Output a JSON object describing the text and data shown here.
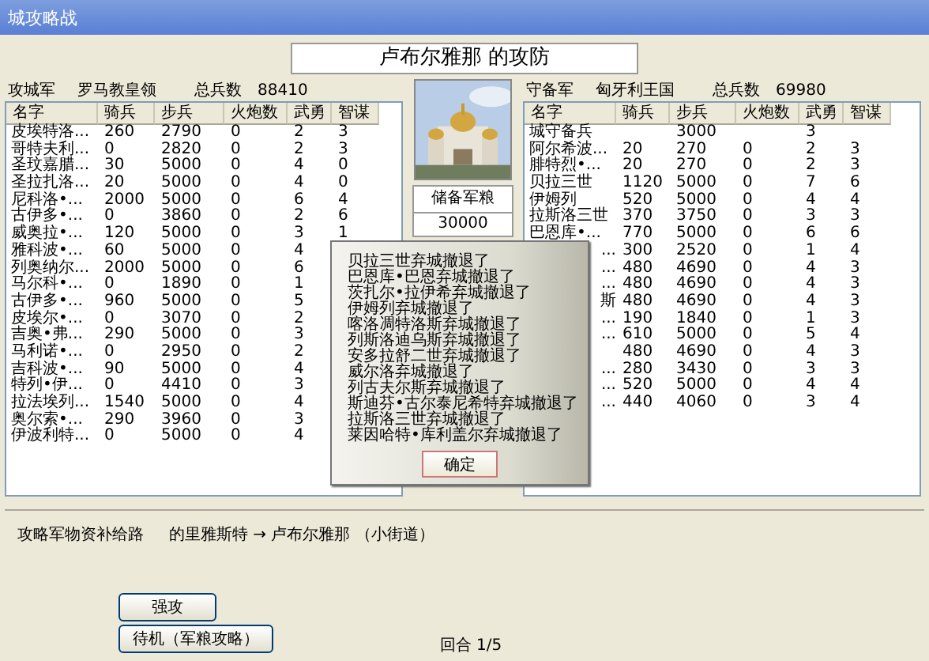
{
  "window": {
    "title": "城攻略战"
  },
  "battle_title": "卢布尔雅那 的攻防",
  "attacker": {
    "columns": [
      "名字",
      "骑兵",
      "步兵",
      "火炮数",
      "武勇",
      "智谋"
    ],
    "label": "攻城军",
    "faction": "罗马教皇领",
    "total_label": "总兵数",
    "total": "88410",
    "rows": [
      {
        "name": "皮埃特洛...",
        "cavalry": "260",
        "infantry": "2790",
        "cannons": "0",
        "valor": "2",
        "wisdom": "3"
      },
      {
        "name": "哥特夫利...",
        "cavalry": "0",
        "infantry": "2820",
        "cannons": "0",
        "valor": "2",
        "wisdom": "3"
      },
      {
        "name": "圣玟嘉腊...",
        "cavalry": "30",
        "infantry": "5000",
        "cannons": "0",
        "valor": "4",
        "wisdom": "0"
      },
      {
        "name": "圣拉扎洛...",
        "cavalry": "20",
        "infantry": "5000",
        "cannons": "0",
        "valor": "4",
        "wisdom": "0"
      },
      {
        "name": "尼科洛•...",
        "cavalry": "2000",
        "infantry": "5000",
        "cannons": "0",
        "valor": "6",
        "wisdom": "4"
      },
      {
        "name": "古伊多•...",
        "cavalry": "0",
        "infantry": "3860",
        "cannons": "0",
        "valor": "2",
        "wisdom": "6"
      },
      {
        "name": "威奥拉•...",
        "cavalry": "120",
        "infantry": "5000",
        "cannons": "0",
        "valor": "3",
        "wisdom": "1"
      },
      {
        "name": "雅科波•...",
        "cavalry": "60",
        "infantry": "5000",
        "cannons": "0",
        "valor": "4"
      },
      {
        "name": "列奥纳尔...",
        "cavalry": "2000",
        "infantry": "5000",
        "cannons": "0",
        "valor": "6"
      },
      {
        "name": "马尔科•...",
        "cavalry": "0",
        "infantry": "1890",
        "cannons": "0",
        "valor": "1"
      },
      {
        "name": "古伊多•...",
        "cavalry": "960",
        "infantry": "5000",
        "cannons": "0",
        "valor": "5"
      },
      {
        "name": "皮埃尔•...",
        "cavalry": "0",
        "infantry": "3070",
        "cannons": "0",
        "valor": "2"
      },
      {
        "name": "吉奥•弗...",
        "cavalry": "290",
        "infantry": "5000",
        "cannons": "0",
        "valor": "3"
      },
      {
        "name": "马利诺•...",
        "cavalry": "0",
        "infantry": "2950",
        "cannons": "0",
        "valor": "2"
      },
      {
        "name": "吉科波•...",
        "cavalry": "90",
        "infantry": "5000",
        "cannons": "0",
        "valor": "4"
      },
      {
        "name": "特列•伊...",
        "cavalry": "0",
        "infantry": "4410",
        "cannons": "0",
        "valor": "3"
      },
      {
        "name": "拉法埃列...",
        "cavalry": "1540",
        "infantry": "5000",
        "cannons": "0",
        "valor": "4"
      },
      {
        "name": "奥尔索•...",
        "cavalry": "290",
        "infantry": "3960",
        "cannons": "0",
        "valor": "3"
      },
      {
        "name": "伊波利特...",
        "cavalry": "0",
        "infantry": "5000",
        "cannons": "0",
        "valor": "4"
      }
    ]
  },
  "defender": {
    "columns": [
      "名字",
      "骑兵",
      "步兵",
      "火炮数",
      "武勇",
      "智谋"
    ],
    "label": "守备军",
    "faction": "匈牙利王国",
    "total_label": "总兵数",
    "total": "69980",
    "rows": [
      {
        "name": "城守备兵",
        "infantry": "3000",
        "valor": "3"
      },
      {
        "name": "阿尔希波...",
        "cavalry": "20",
        "infantry": "270",
        "cannons": "0",
        "valor": "2",
        "wisdom": "3"
      },
      {
        "name": "腓特烈•...",
        "cavalry": "20",
        "infantry": "270",
        "cannons": "0",
        "valor": "2",
        "wisdom": "3"
      },
      {
        "name": "贝拉三世",
        "cavalry": "1120",
        "infantry": "5000",
        "cannons": "0",
        "valor": "7",
        "wisdom": "6"
      },
      {
        "name": "伊姆列",
        "cavalry": "520",
        "infantry": "5000",
        "cannons": "0",
        "valor": "4",
        "wisdom": "4"
      },
      {
        "name": "拉斯洛三世",
        "cavalry": "370",
        "infantry": "3750",
        "cannons": "0",
        "valor": "3",
        "wisdom": "3"
      },
      {
        "name": "巴恩库•...",
        "cavalry": "770",
        "infantry": "5000",
        "cannons": "0",
        "valor": "6",
        "wisdom": "6"
      },
      {
        "name": "...",
        "cavalry": "300",
        "infantry": "2520",
        "cannons": "0",
        "valor": "1",
        "wisdom": "4",
        "kind": "partial"
      },
      {
        "name": "...",
        "cavalry": "480",
        "infantry": "4690",
        "cannons": "0",
        "valor": "4",
        "wisdom": "3",
        "kind": "partial"
      },
      {
        "name": "...",
        "cavalry": "480",
        "infantry": "4690",
        "cannons": "0",
        "valor": "4",
        "wisdom": "3",
        "kind": "partial"
      },
      {
        "name": "斯",
        "cavalry": "480",
        "infantry": "4690",
        "cannons": "0",
        "valor": "4",
        "wisdom": "3",
        "kind": "partial"
      },
      {
        "name": "...",
        "cavalry": "190",
        "infantry": "1840",
        "cannons": "0",
        "valor": "1",
        "wisdom": "3",
        "kind": "partial"
      },
      {
        "name": "...",
        "cavalry": "610",
        "infantry": "5000",
        "cannons": "0",
        "valor": "5",
        "wisdom": "4",
        "kind": "partial"
      },
      {
        "cavalry": "480",
        "infantry": "4690",
        "cannons": "0",
        "valor": "4",
        "wisdom": "3"
      },
      {
        "name": "...",
        "cavalry": "280",
        "infantry": "3430",
        "cannons": "0",
        "valor": "3",
        "wisdom": "3",
        "kind": "partial"
      },
      {
        "name": "...",
        "cavalry": "520",
        "infantry": "5000",
        "cannons": "0",
        "valor": "4",
        "wisdom": "4",
        "kind": "partial"
      },
      {
        "name": "...",
        "cavalry": "440",
        "infantry": "4060",
        "cannons": "0",
        "valor": "3",
        "wisdom": "4",
        "kind": "partial"
      }
    ]
  },
  "city": {
    "kind": "picture",
    "reserve_label": "储备军粮",
    "reserve": "30000"
  },
  "supply": {
    "label": "攻略军物资补给路",
    "route": "的里雅斯特 → 卢布尔雅那 （小街道）"
  },
  "buttons": [
    "强攻",
    "待机（军粮攻略）"
  ],
  "turn": "回合 1/5",
  "dialog": {
    "lines": [
      "贝拉三世弃城撤退了",
      "巴恩库•巴恩弃城撤退了",
      "茨扎尔•拉伊希弃城撤退了",
      "伊姆列弃城撤退了",
      "喀洛凋特洛斯弃城撤退了",
      "列斯洛迪乌斯弃城撤退了",
      "安多拉舒二世弃城撤退了",
      "威尔洛弃城撤退了",
      "列古夫尔斯弃城撤退了",
      "斯迪芬•古尔泰尼希特弃城撤退了",
      "拉斯洛三世弃城撤退了",
      "莱因哈特•库利盖尔弃城撤退了"
    ],
    "button": "确定"
  }
}
